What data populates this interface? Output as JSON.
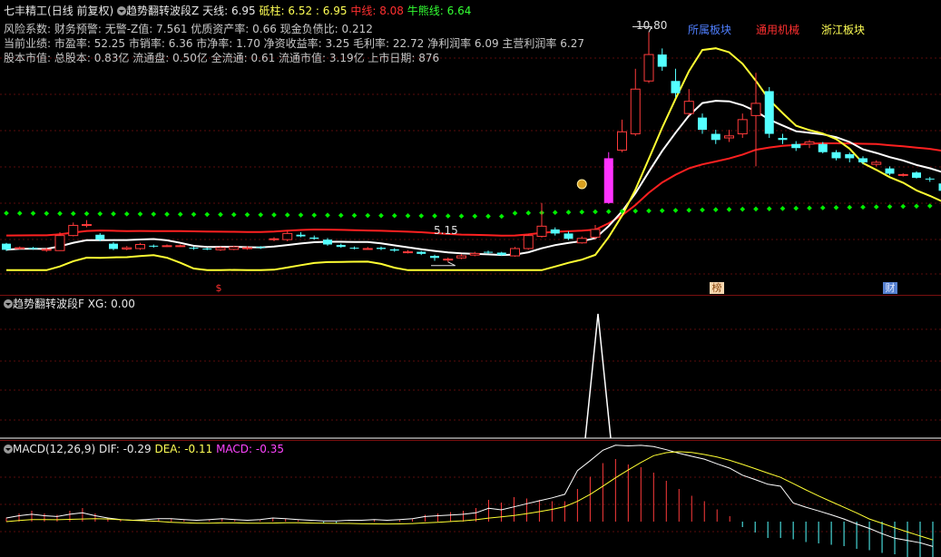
{
  "header": {
    "stock_name": "七丰精工",
    "period": "(日线 前复权)",
    "indicator_name": "趋势翻转波段Z",
    "tianxian_label": "天线:",
    "tianxian_value": "6.95",
    "dizhu_label": "砥柱:",
    "dizhu_value": "6.52 : 6.95",
    "zhongxian_label": "中线:",
    "zhongxian_value": "8.08",
    "niuxiong_label": "牛熊线:",
    "niuxiong_value": "6.64"
  },
  "info_lines": [
    "风险系数: 财务预警: 无警-Z值: 7.561 优质资产率: 0.66 现金负债比: 0.212",
    "当前业绩: 市盈率: 52.25 市销率: 6.36 市净率: 1.70 净资收益率: 3.25 毛利率: 22.72 净利润率 6.09 主营利润率 6.27",
    "股本市值: 总股本: 0.83亿 流通盘: 0.50亿 全流通: 0.61 流通市值: 3.19亿 上市日期: 876"
  ],
  "sector_tags": {
    "belong": "所属板块",
    "industry": "通用机械",
    "region": "浙江板块"
  },
  "annotations": {
    "high_price": "10.80",
    "low_price": "5.15",
    "marker_dollar": "$",
    "marker_bang": "榜",
    "marker_cai": "财"
  },
  "panel2": {
    "indicator_name": "趋势翻转波段F",
    "xg_label": "XG:",
    "xg_value": "0.00"
  },
  "panel3": {
    "indicator_name": "MACD(12,26,9)",
    "dif_label": "DIF:",
    "dif_value": "-0.29",
    "dea_label": "DEA:",
    "dea_value": "-0.11",
    "macd_label": "MACD:",
    "macd_value": "-0.35"
  },
  "colors": {
    "up": "#ff3b3b",
    "down": "#54ffff",
    "mid_line": "#ff2020",
    "white_line": "#ffffff",
    "yellow_line": "#ffff33",
    "green_dots": "#00ee00",
    "signal_bar": "#ff33ff"
  },
  "candles": [
    [
      5.6,
      5.45,
      5.62,
      5.42
    ],
    [
      5.48,
      5.5,
      5.53,
      5.46
    ],
    [
      5.5,
      5.47,
      5.52,
      5.45
    ],
    [
      5.45,
      5.46,
      5.5,
      5.4
    ],
    [
      5.43,
      5.8,
      5.88,
      5.42
    ],
    [
      5.8,
      6.05,
      6.12,
      5.78
    ],
    [
      6.05,
      6.07,
      6.18,
      6.0
    ],
    [
      5.82,
      5.7,
      5.86,
      5.66
    ],
    [
      5.6,
      5.47,
      5.64,
      5.44
    ],
    [
      5.47,
      5.5,
      5.54,
      5.44
    ],
    [
      5.48,
      5.58,
      5.62,
      5.45
    ],
    [
      5.55,
      5.54,
      5.58,
      5.5
    ],
    [
      5.55,
      5.55,
      5.58,
      5.52
    ],
    [
      5.55,
      5.55,
      5.58,
      5.52
    ],
    [
      5.5,
      5.48,
      5.53,
      5.45
    ],
    [
      5.48,
      5.47,
      5.5,
      5.44
    ],
    [
      5.45,
      5.5,
      5.53,
      5.42
    ],
    [
      5.46,
      5.52,
      5.55,
      5.44
    ],
    [
      5.48,
      5.5,
      5.54,
      5.45
    ],
    [
      5.52,
      5.5,
      5.54,
      5.47
    ],
    [
      5.7,
      5.72,
      5.76,
      5.66
    ],
    [
      5.7,
      5.85,
      5.92,
      5.66
    ],
    [
      5.82,
      5.78,
      5.88,
      5.76
    ],
    [
      5.75,
      5.72,
      5.8,
      5.7
    ],
    [
      5.7,
      5.58,
      5.74,
      5.55
    ],
    [
      5.57,
      5.52,
      5.6,
      5.5
    ],
    [
      5.5,
      5.48,
      5.53,
      5.46
    ],
    [
      5.48,
      5.48,
      5.52,
      5.45
    ],
    [
      5.5,
      5.47,
      5.53,
      5.44
    ],
    [
      5.46,
      5.43,
      5.49,
      5.4
    ],
    [
      5.4,
      5.4,
      5.44,
      5.36
    ],
    [
      5.4,
      5.35,
      5.42,
      5.32
    ],
    [
      5.3,
      5.25,
      5.33,
      5.18
    ],
    [
      5.2,
      5.22,
      5.26,
      5.15
    ],
    [
      5.25,
      5.3,
      5.34,
      5.22
    ],
    [
      5.32,
      5.36,
      5.4,
      5.29
    ],
    [
      5.4,
      5.38,
      5.43,
      5.35
    ],
    [
      5.38,
      5.32,
      5.4,
      5.3
    ],
    [
      5.3,
      5.48,
      5.52,
      5.28
    ],
    [
      5.48,
      5.8,
      5.84,
      5.45
    ],
    [
      5.78,
      6.03,
      6.6,
      5.75
    ],
    [
      5.95,
      5.85,
      6.0,
      5.8
    ],
    [
      5.85,
      5.72,
      5.9,
      5.69
    ],
    [
      5.62,
      5.73,
      5.78,
      5.6
    ],
    [
      5.76,
      5.95,
      6.06,
      5.72
    ],
    [
      6.6,
      7.7,
      7.85,
      6.58
    ],
    [
      7.9,
      8.35,
      8.65,
      7.85
    ],
    [
      8.3,
      9.4,
      9.9,
      8.25
    ],
    [
      9.6,
      10.25,
      10.8,
      9.55
    ],
    [
      10.25,
      9.95,
      10.4,
      9.85
    ],
    [
      9.6,
      9.3,
      9.9,
      9.2
    ],
    [
      8.8,
      9.1,
      9.4,
      8.75
    ],
    [
      8.7,
      8.4,
      8.8,
      8.3
    ],
    [
      8.3,
      8.15,
      8.4,
      8.05
    ],
    [
      8.2,
      8.25,
      8.4,
      8.1
    ],
    [
      8.3,
      8.65,
      8.8,
      8.2
    ],
    [
      8.75,
      9.05,
      9.8,
      7.5
    ],
    [
      9.35,
      8.3,
      9.45,
      8.2
    ],
    [
      8.2,
      8.15,
      8.3,
      8.05
    ],
    [
      8.05,
      7.95,
      8.12,
      7.88
    ],
    [
      8.05,
      8.1,
      8.15,
      7.95
    ],
    [
      8.05,
      7.85,
      8.1,
      7.82
    ],
    [
      7.85,
      7.7,
      7.9,
      7.65
    ],
    [
      7.8,
      7.7,
      7.84,
      7.6
    ],
    [
      7.7,
      7.6,
      7.75,
      7.55
    ],
    [
      7.55,
      7.6,
      7.65,
      7.5
    ],
    [
      7.45,
      7.32,
      7.5,
      7.28
    ],
    [
      7.3,
      7.3,
      7.33,
      7.25
    ],
    [
      7.35,
      7.22,
      7.38,
      7.2
    ],
    [
      7.2,
      7.18,
      7.24,
      7.12
    ],
    [
      7.08,
      6.9,
      7.12,
      6.85
    ],
    [
      6.85,
      6.85,
      6.88,
      6.8
    ],
    [
      6.95,
      6.85,
      7.0,
      6.82
    ],
    [
      6.9,
      7.05,
      7.08,
      6.85
    ]
  ],
  "xg_signal_index": 45,
  "macd_hist": [
    0.03,
    0.06,
    0.08,
    0.06,
    0.05,
    0.08,
    0.1,
    0.06,
    0.03,
    0.01,
    0.0,
    0.01,
    0.02,
    0.02,
    0.01,
    0.0,
    0.01,
    0.02,
    0.01,
    0.0,
    0.01,
    0.03,
    0.02,
    0.01,
    0.0,
    -0.01,
    -0.01,
    0.0,
    0.0,
    0.01,
    0.0,
    0.01,
    0.02,
    0.05,
    0.06,
    0.07,
    0.08,
    0.1,
    0.16,
    0.14,
    0.18,
    0.17,
    0.16,
    0.15,
    0.15,
    0.24,
    0.33,
    0.43,
    0.46,
    0.42,
    0.4,
    0.36,
    0.3,
    0.24,
    0.19,
    0.15,
    0.09,
    0.04,
    -0.04,
    -0.08,
    -0.12,
    -0.12,
    -0.13,
    -0.15,
    -0.16,
    -0.17,
    -0.18,
    -0.2,
    -0.21,
    -0.23,
    -0.24,
    -0.27,
    -0.3,
    -0.35
  ]
}
